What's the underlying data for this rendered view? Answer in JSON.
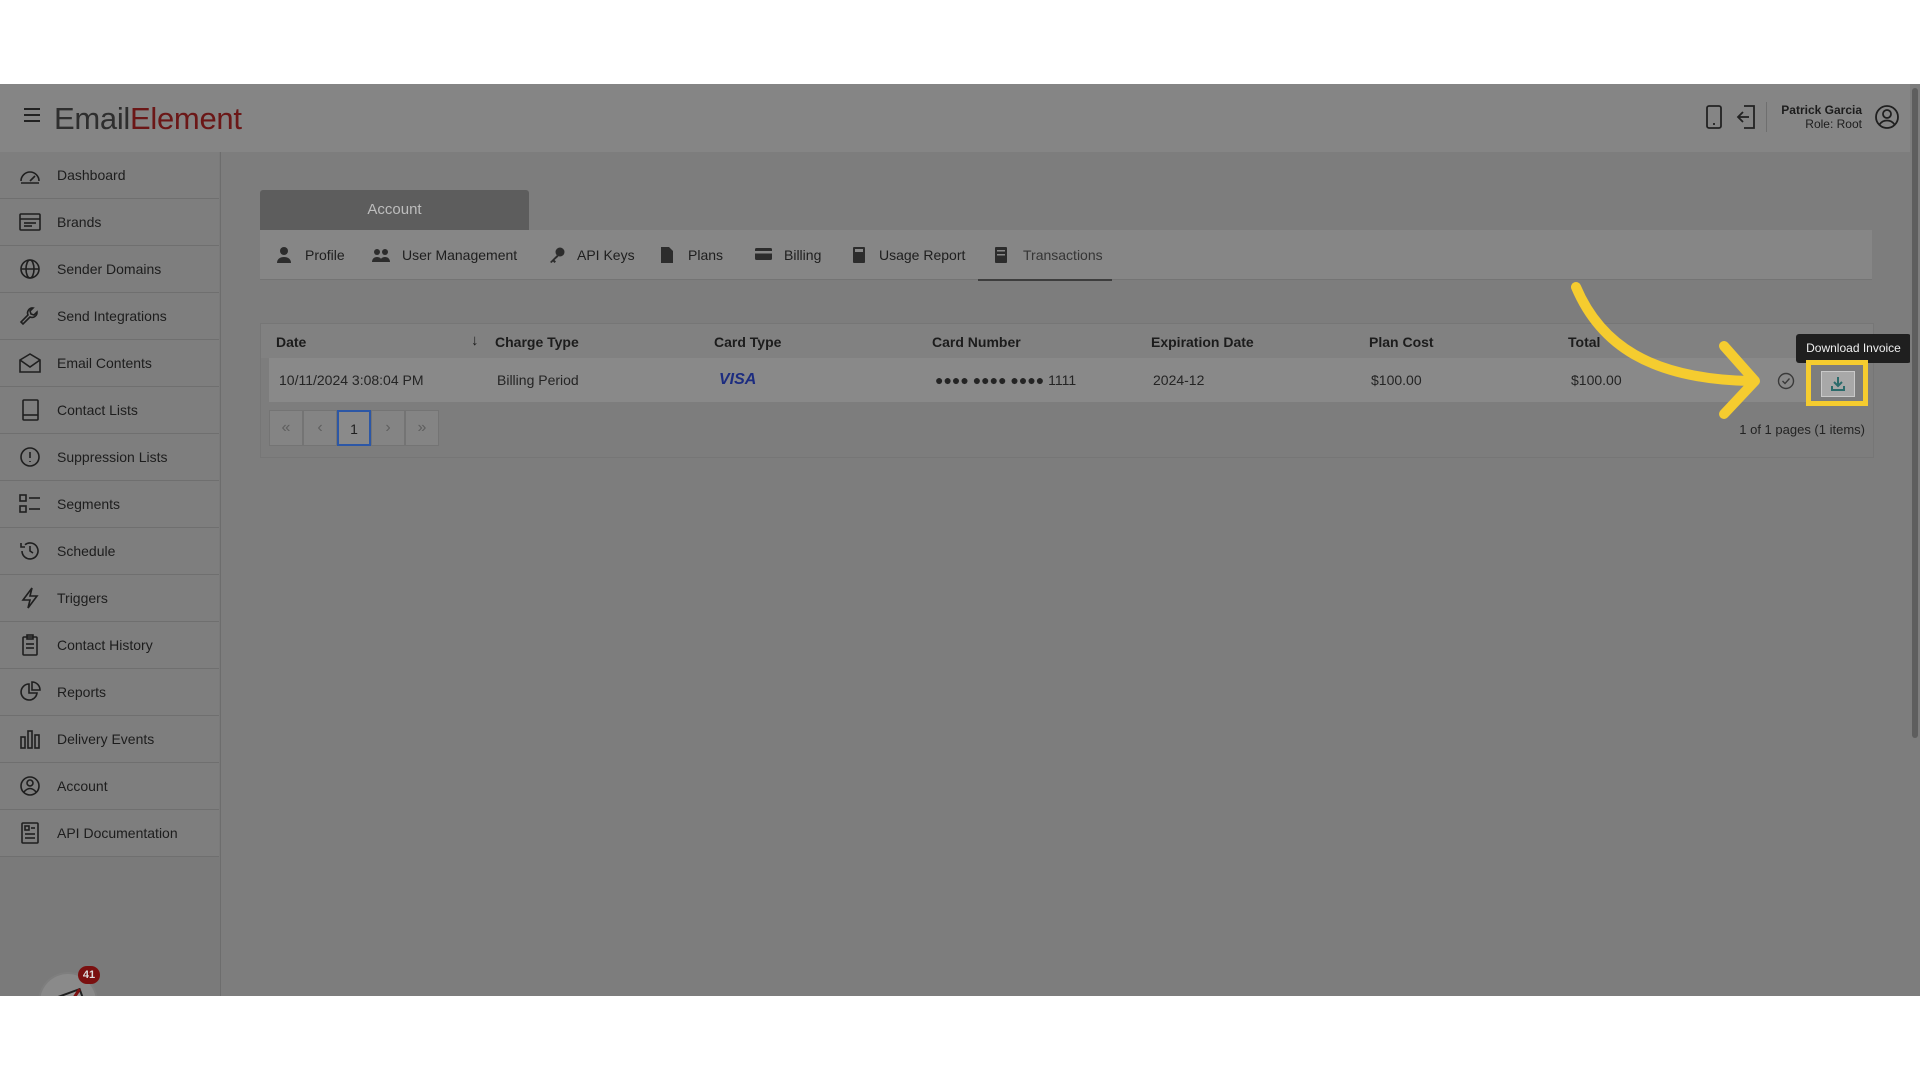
{
  "header": {
    "logo_part1": "Em",
    "logo_part2": "ail",
    "logo_part3": "Element",
    "user_name": "Patrick Garcia",
    "user_role": "Role: Root",
    "icons": [
      "menu-icon",
      "mobile-icon",
      "logout-icon",
      "user-circle-icon"
    ]
  },
  "sidebar": {
    "items": [
      {
        "label": "Dashboard",
        "icon": "gauge-icon"
      },
      {
        "label": "Brands",
        "icon": "brands-icon"
      },
      {
        "label": "Sender Domains",
        "icon": "globe-icon"
      },
      {
        "label": "Send Integrations",
        "icon": "wrench-icon"
      },
      {
        "label": "Email Contents",
        "icon": "envelope-icon"
      },
      {
        "label": "Contact Lists",
        "icon": "book-icon"
      },
      {
        "label": "Suppression Lists",
        "icon": "alert-circle-icon"
      },
      {
        "label": "Segments",
        "icon": "segments-icon"
      },
      {
        "label": "Schedule",
        "icon": "history-icon"
      },
      {
        "label": "Triggers",
        "icon": "lightning-icon"
      },
      {
        "label": "Contact History",
        "icon": "clipboard-icon"
      },
      {
        "label": "Reports",
        "icon": "pie-chart-icon"
      },
      {
        "label": "Delivery Events",
        "icon": "bar-chart-icon"
      },
      {
        "label": "Account",
        "icon": "user-circle-icon"
      },
      {
        "label": "API Documentation",
        "icon": "document-icon"
      }
    ],
    "notification_count": "41"
  },
  "account": {
    "header": "Account",
    "tabs": [
      {
        "label": "Profile",
        "icon": "person-icon"
      },
      {
        "label": "User Management",
        "icon": "users-icon"
      },
      {
        "label": "API Keys",
        "icon": "key-icon"
      },
      {
        "label": "Plans",
        "icon": "file-icon"
      },
      {
        "label": "Billing",
        "icon": "credit-card-icon"
      },
      {
        "label": "Usage Report",
        "icon": "calculator-icon"
      },
      {
        "label": "Transactions",
        "icon": "receipt-icon",
        "active": true
      }
    ]
  },
  "transactions": {
    "columns": [
      "Date",
      "Charge Type",
      "Card Type",
      "Card Number",
      "Expiration Date",
      "Plan Cost",
      "Total"
    ],
    "rows": [
      {
        "date": "10/11/2024 3:08:04 PM",
        "charge_type": "Billing Period",
        "card_type": "VISA",
        "card_number": "●●●● ●●●● ●●●● 1111",
        "expiration": "2024-12",
        "plan_cost": "$100.00",
        "total": "$100.00"
      }
    ],
    "pager": {
      "first": "«",
      "prev": "‹",
      "current_page": "1",
      "next": "›",
      "last": "»",
      "info": "1 of 1 pages (1 items)"
    },
    "tooltip": "Download Invoice"
  },
  "colors": {
    "highlight": "#f5cc2f",
    "logo_accent": "#6b1717",
    "overlay": "#7d7d7d"
  }
}
